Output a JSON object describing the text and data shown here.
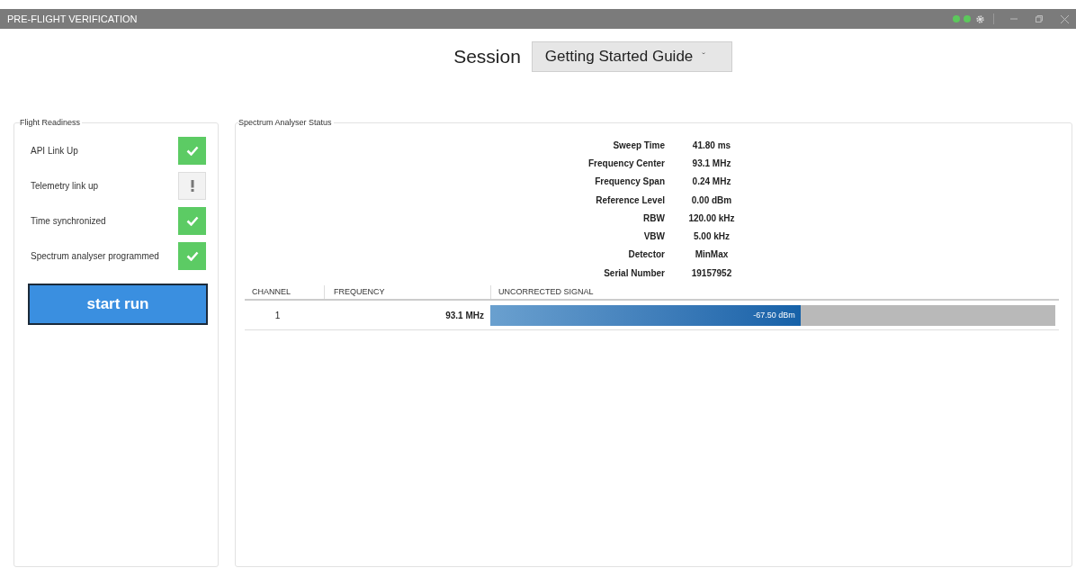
{
  "window": {
    "title": "PRE-FLIGHT VERIFICATION",
    "status_dots": [
      {
        "color": "#5cc85c"
      },
      {
        "color": "#5cc85c"
      }
    ]
  },
  "session": {
    "label": "Session",
    "value": "Getting Started Guide",
    "caret": "ˇ"
  },
  "flight_readiness": {
    "title": "Flight Readiness",
    "items": [
      {
        "kind": "ok",
        "label": "API Link Up"
      },
      {
        "kind": "warning",
        "label": "Telemetry link up"
      },
      {
        "kind": "ok",
        "label": "Time synchronized"
      },
      {
        "kind": "ok",
        "label": "Spectrum analyser programmed"
      }
    ],
    "button": "start run"
  },
  "spectrum": {
    "title": "Spectrum Analyser Status",
    "fields": [
      {
        "label": "Sweep Time",
        "value": "41.80 ms"
      },
      {
        "label": "Frequency Center",
        "value": "93.1 MHz"
      },
      {
        "label": "Frequency Span",
        "value": "0.24 MHz"
      },
      {
        "label": "Reference Level",
        "value": "0.00 dBm"
      },
      {
        "label": "RBW",
        "value": "120.00 kHz"
      },
      {
        "label": "VBW",
        "value": "5.00 kHz"
      },
      {
        "label": "Detector",
        "value": "MinMax"
      },
      {
        "label": "Serial Number",
        "value": "19157952"
      }
    ],
    "table": {
      "columns": [
        "CHANNEL",
        "FREQUENCY",
        "UNCORRECTED SIGNAL"
      ],
      "rows": [
        {
          "channel": "1",
          "frequency": "93.1 MHz",
          "reading": "-67.50 dBm",
          "level": 0.549
        }
      ]
    }
  }
}
